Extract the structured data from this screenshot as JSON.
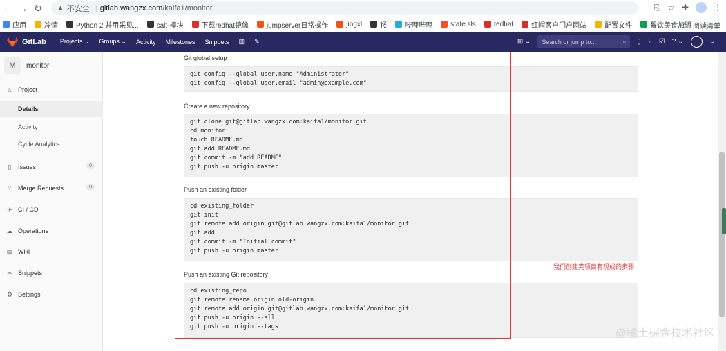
{
  "browser": {
    "security_label": "不安全",
    "url_host": "gitlab.wangzx.com",
    "url_path": "/kaifa1/monitor",
    "bookmarks": [
      {
        "label": "应用",
        "color": "#4285f4"
      },
      {
        "label": "冷情",
        "color": "#f4b400"
      },
      {
        "label": "Python 2 并用采见...",
        "color": "#333333"
      },
      {
        "label": "salt-模块",
        "color": "#333333"
      },
      {
        "label": "下载redhat镜像",
        "color": "#d93025"
      },
      {
        "label": "jumpserver日常操作",
        "color": "#f4511e"
      },
      {
        "label": "jingxl",
        "color": "#f4511e"
      },
      {
        "label": "猴",
        "color": "#333333"
      },
      {
        "label": "哔哩哔哩",
        "color": "#23ade5"
      },
      {
        "label": "state.sls",
        "color": "#f4511e"
      },
      {
        "label": "redhat",
        "color": "#d93025"
      },
      {
        "label": "红帽客户门户网站",
        "color": "#d93025"
      },
      {
        "label": "配置文件",
        "color": "#f4b400"
      },
      {
        "label": "餐饮美食加盟",
        "color": "#0f9d58"
      }
    ],
    "more_label": "»",
    "reading_list_label": "阅读清单"
  },
  "gitlab": {
    "brand": "GitLab",
    "nav": [
      "Projects ⌄",
      "Groups ⌄",
      "Activity",
      "Milestones",
      "Snippets"
    ],
    "search_placeholder": "Search or jump to...",
    "accent": "#292961"
  },
  "sidebar": {
    "project_initial": "M",
    "project_name": "monitor",
    "items": [
      {
        "label": "Project",
        "icon": "home-icon"
      },
      {
        "label": "Details"
      },
      {
        "label": "Activity"
      },
      {
        "label": "Cycle Analytics"
      },
      {
        "label": "Issues",
        "icon": "issues-icon",
        "badge": "0"
      },
      {
        "label": "Merge Requests",
        "icon": "merge-request-icon",
        "badge": "0"
      },
      {
        "label": "CI / CD",
        "icon": "rocket-icon"
      },
      {
        "label": "Operations",
        "icon": "cloud-icon"
      },
      {
        "label": "Wiki",
        "icon": "book-icon"
      },
      {
        "label": "Snippets",
        "icon": "scissors-icon"
      },
      {
        "label": "Settings",
        "icon": "gear-icon"
      }
    ]
  },
  "main": {
    "sections": [
      {
        "title": "Git global setup",
        "code": "git config --global user.name \"Administrator\"\ngit config --global user.email \"admin@example.com\""
      },
      {
        "title": "Create a new repository",
        "code": "git clone git@gitlab.wangzx.com:kaifa1/monitor.git\ncd monitor\ntouch README.md\ngit add README.md\ngit commit -m \"add README\"\ngit push -u origin master"
      },
      {
        "title": "Push an existing folder",
        "code": "cd existing_folder\ngit init\ngit remote add origin git@gitlab.wangzx.com:kaifa1/monitor.git\ngit add .\ngit commit -m \"Initial commit\"\ngit push -u origin master"
      },
      {
        "title": "Push an existing Git repository",
        "code": "cd existing_repo\ngit remote rename origin old-origin\ngit remote add origin git@gitlab.wangzx.com:kaifa1/monitor.git\ngit push -u origin --all\ngit push -u origin --tags"
      }
    ],
    "annotation": "我们创建完项目有现成的步骤",
    "annotation_color": "#e8373a"
  },
  "watermark": "@稀土掘金技术社区"
}
